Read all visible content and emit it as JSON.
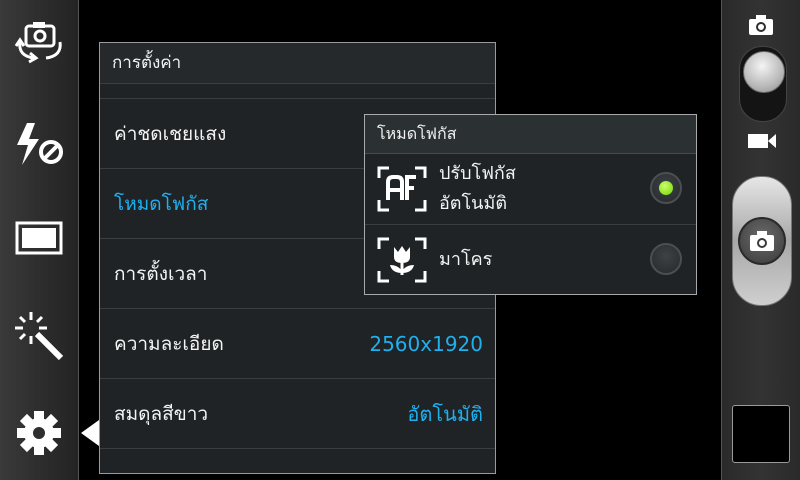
{
  "left_toolbar": {
    "icons": [
      "camera-switch-icon",
      "flash-off-icon",
      "aspect-ratio-icon",
      "effects-wand-icon",
      "settings-gear-icon"
    ]
  },
  "settings": {
    "title": "การตั้งค่า",
    "rows": [
      {
        "label": "ค่าชดเชยแสง",
        "value": ""
      },
      {
        "label": "โหมดโฟกัส",
        "value": ""
      },
      {
        "label": "การตั้งเวลา",
        "value": ""
      },
      {
        "label": "ความละเอียด",
        "value": "2560x1920"
      },
      {
        "label": "สมดุลสีขาว",
        "value": "อัตโนมัติ"
      }
    ]
  },
  "focus_popup": {
    "title": "โหมดโฟกัส",
    "options": [
      {
        "line1": "ปรับโฟกัส",
        "line2": "อัตโนมัติ",
        "icon": "autofocus-icon",
        "selected": true
      },
      {
        "line1": "มาโคร",
        "line2": "",
        "icon": "macro-flower-icon",
        "selected": false
      }
    ]
  },
  "right_bar": {
    "mode_icons": [
      "camera-mode-icon",
      "video-mode-icon"
    ],
    "shutter_icon": "camera-shutter-icon"
  },
  "colors": {
    "accent": "#1fb0ee",
    "radio_selected": "#8ee02a"
  }
}
